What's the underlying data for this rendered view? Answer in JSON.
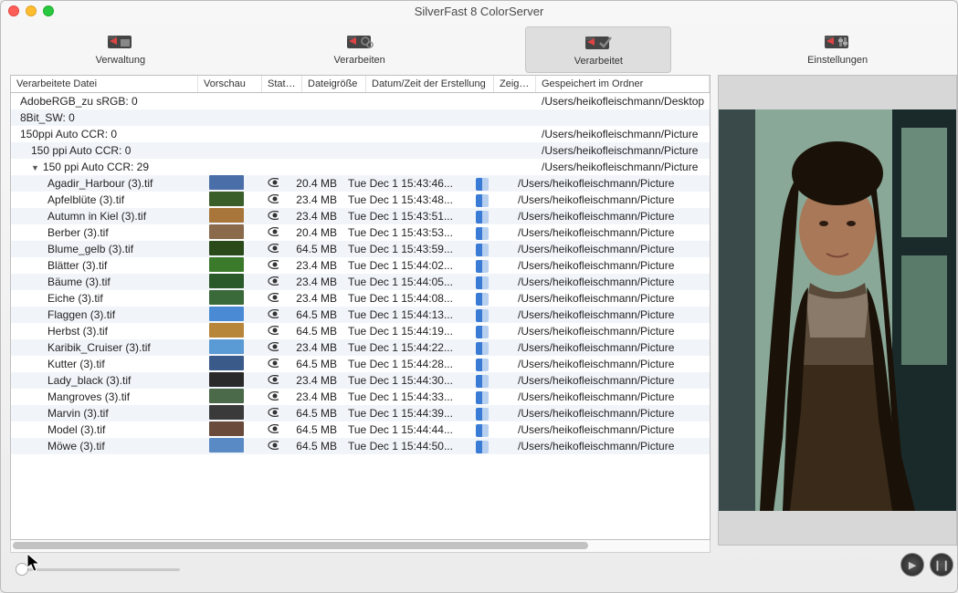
{
  "window": {
    "title": "SilverFast 8 ColorServer"
  },
  "tabs": [
    {
      "id": "verwaltung",
      "label": "Verwaltung"
    },
    {
      "id": "verarbeiten",
      "label": "Verarbeiten"
    },
    {
      "id": "verarbeitet",
      "label": "Verarbeitet",
      "selected": true
    },
    {
      "id": "einstellungen",
      "label": "Einstellungen"
    }
  ],
  "columns": {
    "file": "Verarbeitete Datei",
    "preview": "Vorschau",
    "status": "Status",
    "size": "Dateigröße",
    "date": "Datum/Zeit der Erstellung",
    "show": "Zeige i",
    "path": "Gespeichert im Ordner"
  },
  "groups": [
    {
      "name": "AdobeRGB_zu sRGB: 0",
      "indent": 0,
      "path": "/Users/heikofleischmann/Desktop"
    },
    {
      "name": "8Bit_SW: 0",
      "indent": 0,
      "path": ""
    },
    {
      "name": "150ppi Auto CCR: 0",
      "indent": 0,
      "path": "/Users/heikofleischmann/Picture"
    },
    {
      "name": "150 ppi Auto CCR: 0",
      "indent": 1,
      "path": "/Users/heikofleischmann/Picture"
    },
    {
      "name": "150 ppi Auto CCR: 29",
      "indent": 1,
      "open": true,
      "path": "/Users/heikofleischmann/Picture"
    }
  ],
  "files": [
    {
      "name": "Agadir_Harbour (3).tif",
      "size": "20.4 MB",
      "date": "Tue Dec 1 15:43:46...",
      "path": "/Users/heikofleischmann/Picture",
      "thumb": "#4a6fa8"
    },
    {
      "name": "Apfelblüte (3).tif",
      "size": "23.4 MB",
      "date": "Tue Dec 1 15:43:48...",
      "path": "/Users/heikofleischmann/Picture",
      "thumb": "#3a5f2a"
    },
    {
      "name": "Autumn in Kiel (3).tif",
      "size": "23.4 MB",
      "date": "Tue Dec 1 15:43:51...",
      "path": "/Users/heikofleischmann/Picture",
      "thumb": "#a8763a"
    },
    {
      "name": "Berber (3).tif",
      "size": "20.4 MB",
      "date": "Tue Dec 1 15:43:53...",
      "path": "/Users/heikofleischmann/Picture",
      "thumb": "#8a6a4a"
    },
    {
      "name": "Blume_gelb (3).tif",
      "size": "64.5 MB",
      "date": "Tue Dec 1 15:43:59...",
      "path": "/Users/heikofleischmann/Picture",
      "thumb": "#2a4a1a"
    },
    {
      "name": "Blätter (3).tif",
      "size": "23.4 MB",
      "date": "Tue Dec 1 15:44:02...",
      "path": "/Users/heikofleischmann/Picture",
      "thumb": "#3a7a2a"
    },
    {
      "name": "Bäume (3).tif",
      "size": "23.4 MB",
      "date": "Tue Dec 1 15:44:05...",
      "path": "/Users/heikofleischmann/Picture",
      "thumb": "#2a5a2a"
    },
    {
      "name": "Eiche (3).tif",
      "size": "23.4 MB",
      "date": "Tue Dec 1 15:44:08...",
      "path": "/Users/heikofleischmann/Picture",
      "thumb": "#3a6a3a"
    },
    {
      "name": "Flaggen (3).tif",
      "size": "64.5 MB",
      "date": "Tue Dec 1 15:44:13...",
      "path": "/Users/heikofleischmann/Picture",
      "thumb": "#4a8ad5"
    },
    {
      "name": "Herbst (3).tif",
      "size": "64.5 MB",
      "date": "Tue Dec 1 15:44:19...",
      "path": "/Users/heikofleischmann/Picture",
      "thumb": "#b8863a"
    },
    {
      "name": "Karibik_Cruiser (3).tif",
      "size": "23.4 MB",
      "date": "Tue Dec 1 15:44:22...",
      "path": "/Users/heikofleischmann/Picture",
      "thumb": "#5a9ad5"
    },
    {
      "name": "Kutter (3).tif",
      "size": "64.5 MB",
      "date": "Tue Dec 1 15:44:28...",
      "path": "/Users/heikofleischmann/Picture",
      "thumb": "#3a5a8a"
    },
    {
      "name": "Lady_black (3).tif",
      "size": "23.4 MB",
      "date": "Tue Dec 1 15:44:30...",
      "path": "/Users/heikofleischmann/Picture",
      "thumb": "#2a2a2a"
    },
    {
      "name": "Mangroves (3).tif",
      "size": "23.4 MB",
      "date": "Tue Dec 1 15:44:33...",
      "path": "/Users/heikofleischmann/Picture",
      "thumb": "#4a6a4a"
    },
    {
      "name": "Marvin (3).tif",
      "size": "64.5 MB",
      "date": "Tue Dec 1 15:44:39...",
      "path": "/Users/heikofleischmann/Picture",
      "thumb": "#3a3a3a"
    },
    {
      "name": "Model (3).tif",
      "size": "64.5 MB",
      "date": "Tue Dec 1 15:44:44...",
      "path": "/Users/heikofleischmann/Picture",
      "thumb": "#6a4a3a"
    },
    {
      "name": "Möwe (3).tif",
      "size": "64.5 MB",
      "date": "Tue Dec 1 15:44:50...",
      "path": "/Users/heikofleischmann/Picture",
      "thumb": "#5a8ac5"
    }
  ],
  "controls": {
    "play": "▶",
    "pause": "❙❙"
  }
}
